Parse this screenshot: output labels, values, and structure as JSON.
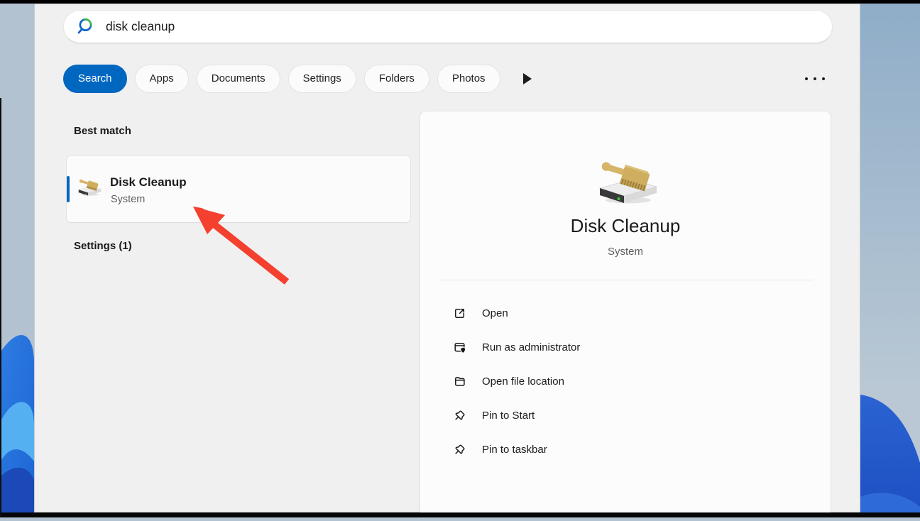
{
  "search_bar": {
    "icon": "search-icon",
    "query": "disk cleanup"
  },
  "filter_tabs": {
    "tabs": [
      {
        "label": "Search",
        "active": true
      },
      {
        "label": "Apps",
        "active": false
      },
      {
        "label": "Documents",
        "active": false
      },
      {
        "label": "Settings",
        "active": false
      },
      {
        "label": "Folders",
        "active": false
      },
      {
        "label": "Photos",
        "active": false
      }
    ],
    "more_tabs_icon": "play-icon",
    "overflow_icon": "ellipsis-icon"
  },
  "results": {
    "best_match_heading": "Best match",
    "best_match_item": {
      "icon": "disk-cleanup-icon",
      "title": "Disk Cleanup",
      "subtitle": "System"
    },
    "settings_heading": "Settings (1)"
  },
  "preview": {
    "icon": "disk-cleanup-icon",
    "title": "Disk Cleanup",
    "subtitle": "System",
    "actions": [
      {
        "icon": "open-icon",
        "label": "Open"
      },
      {
        "icon": "run-as-administrator-icon",
        "label": "Run as administrator"
      },
      {
        "icon": "folder-icon",
        "label": "Open file location"
      },
      {
        "icon": "pin-icon",
        "label": "Pin to Start"
      },
      {
        "icon": "pin-icon",
        "label": "Pin to taskbar"
      }
    ]
  },
  "annotation": {
    "arrow_color": "#f4402e"
  },
  "colors": {
    "accent": "#0067c0",
    "panel_bg": "#f0f0f0",
    "card_bg": "#fbfbfb"
  }
}
